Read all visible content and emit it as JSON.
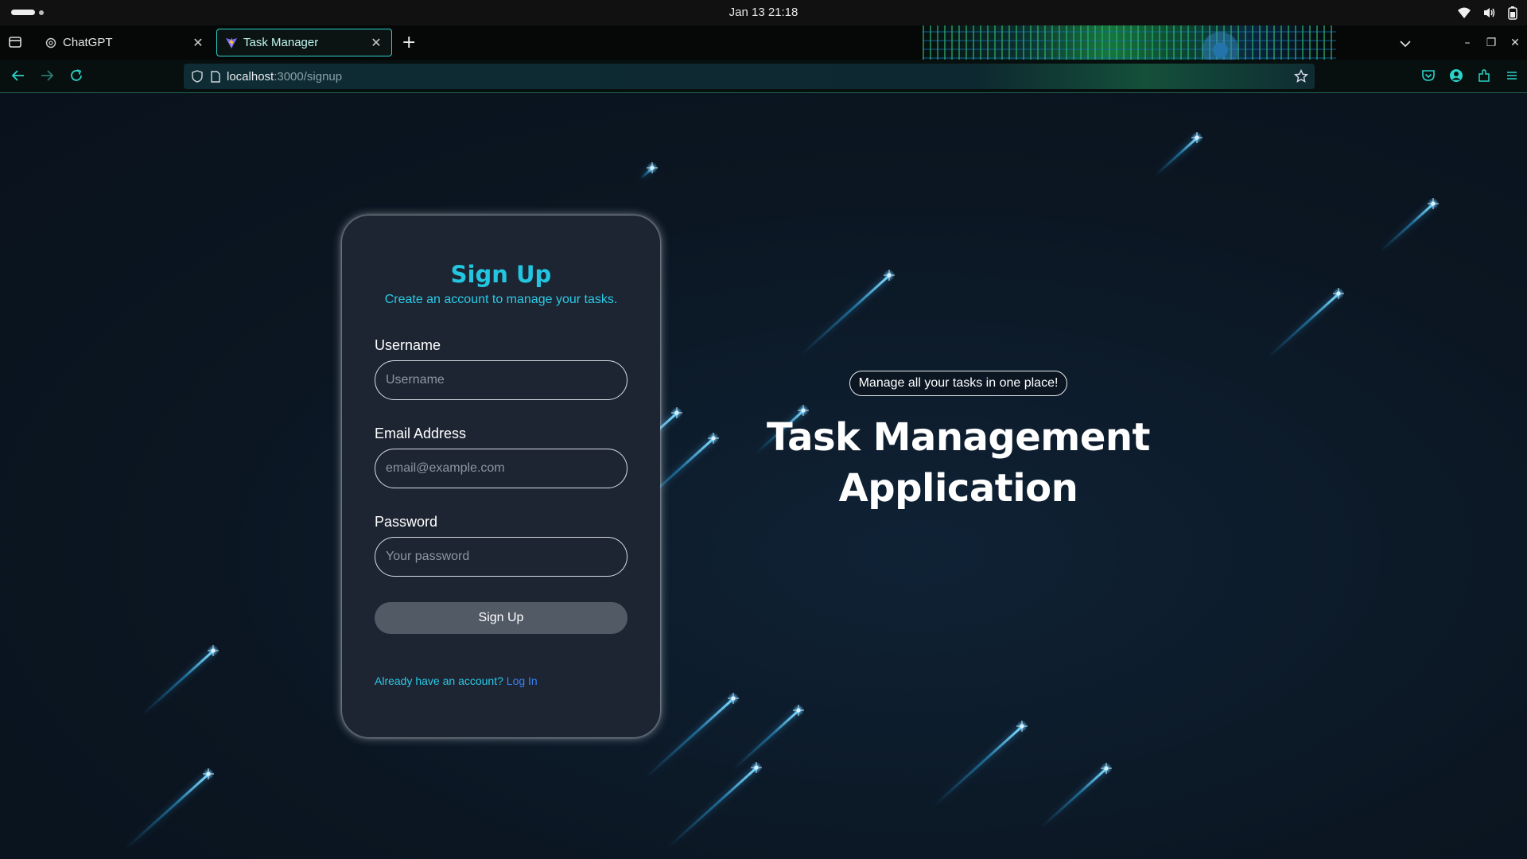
{
  "system": {
    "clock": "Jan 13  21:18"
  },
  "browser": {
    "tabs": [
      {
        "title": "ChatGPT",
        "active": false,
        "icon": "chatgpt-icon"
      },
      {
        "title": "Task Manager",
        "active": true,
        "icon": "vite-icon"
      }
    ],
    "url_host": "localhost",
    "url_path": ":3000/signup",
    "accent": "#2ad3c8"
  },
  "signup": {
    "title": "Sign Up",
    "subtitle": "Create an account to manage your tasks.",
    "username_label": "Username",
    "username_placeholder": "Username",
    "email_label": "Email Address",
    "email_placeholder": "email@example.com",
    "password_label": "Password",
    "password_placeholder": "Your password",
    "submit_label": "Sign Up",
    "login_prompt": "Already have an account?",
    "login_link": "Log In",
    "accent": "#22c6e0"
  },
  "hero": {
    "badge": "Manage all your tasks in one place!",
    "title_line1": "Task Management",
    "title_line2": "Application"
  }
}
